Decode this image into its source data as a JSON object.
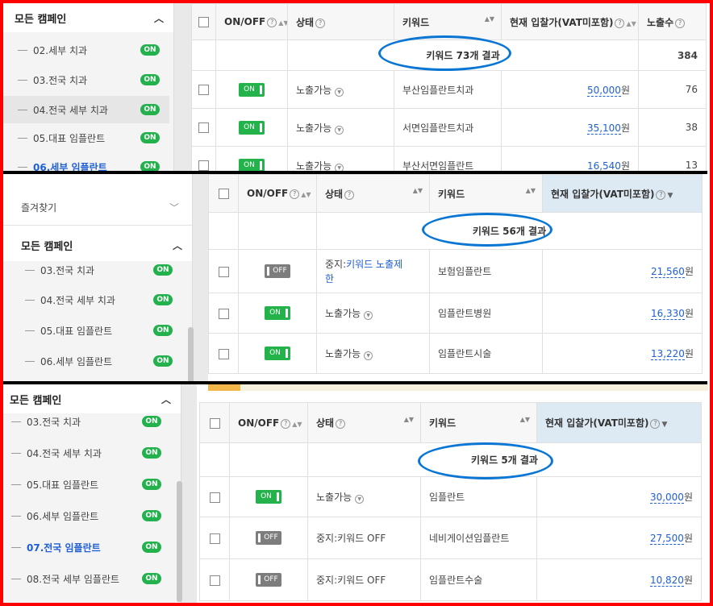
{
  "panels": [
    {
      "sidebar": {
        "header": "모든 캠페인",
        "items": [
          {
            "label": "02.세부 치과",
            "badge": "ON"
          },
          {
            "label": "03.전국 치과",
            "badge": "ON"
          },
          {
            "label": "04.전국 세부 치과",
            "badge": "ON"
          },
          {
            "label": "05.대표 임플란트",
            "badge": "ON"
          },
          {
            "label": "06.세부 임플란트",
            "badge": "ON"
          }
        ]
      },
      "table": {
        "headers": {
          "onoff": "ON/OFF",
          "status": "상태",
          "keyword": "키워드",
          "bid": "현재 입찰가(VAT미포함)",
          "impressions": "노출수"
        },
        "result": "키워드 73개 결과",
        "total_impressions": "384",
        "rows": [
          {
            "toggle": "ON",
            "status": "노출가능",
            "keyword": "부산임플란트치과",
            "bid": "50,000",
            "unit": "원",
            "impressions": "76"
          },
          {
            "toggle": "ON",
            "status": "노출가능",
            "keyword": "서면임플란트치과",
            "bid": "35,100",
            "unit": "원",
            "impressions": "38"
          },
          {
            "toggle": "ON",
            "status": "노출가능",
            "keyword": "부산서면임플란트",
            "bid": "16,540",
            "unit": "원",
            "impressions": "13"
          }
        ]
      }
    },
    {
      "sidebar": {
        "favorites": "즐겨찾기",
        "header": "모든 캠페인",
        "items": [
          {
            "label": "03.전국 치과",
            "badge": "ON"
          },
          {
            "label": "04.전국 세부 치과",
            "badge": "ON"
          },
          {
            "label": "05.대표 임플란트",
            "badge": "ON"
          },
          {
            "label": "06.세부 임플란트",
            "badge": "ON"
          }
        ]
      },
      "table": {
        "headers": {
          "onoff": "ON/OFF",
          "status": "상태",
          "keyword": "키워드",
          "bid": "현재 입찰가(VAT미포함)"
        },
        "result": "키워드 56개 결과",
        "rows": [
          {
            "toggle": "OFF",
            "status_prefix": "중지:",
            "status_link": "키워드 노출제",
            "status_link2": "한",
            "keyword": "보험임플란트",
            "bid": "21,560",
            "unit": "원"
          },
          {
            "toggle": "ON",
            "status": "노출가능",
            "keyword": "임플란트병원",
            "bid": "16,330",
            "unit": "원"
          },
          {
            "toggle": "ON",
            "status": "노출가능",
            "keyword": "임플란트시술",
            "bid": "13,220",
            "unit": "원"
          }
        ]
      }
    },
    {
      "sidebar": {
        "header": "모든 캠페인",
        "items": [
          {
            "label": "03.전국 치과",
            "badge": "ON"
          },
          {
            "label": "04.전국 세부 치과",
            "badge": "ON"
          },
          {
            "label": "05.대표 임플란트",
            "badge": "ON"
          },
          {
            "label": "06.세부 임플란트",
            "badge": "ON"
          },
          {
            "label": "07.전국 임플란트",
            "badge": "ON"
          },
          {
            "label": "08.전국 세부 임플란트",
            "badge": "ON"
          }
        ]
      },
      "table": {
        "headers": {
          "onoff": "ON/OFF",
          "status": "상태",
          "keyword": "키워드",
          "bid": "현재 입찰가(VAT미포함)"
        },
        "result": "키워드 5개 결과",
        "rows": [
          {
            "toggle": "ON",
            "status": "노출가능",
            "keyword": "임플란트",
            "bid": "30,000",
            "unit": "원"
          },
          {
            "toggle": "OFF",
            "status": "중지:키워드 OFF",
            "keyword": "네비게이션임플란트",
            "bid": "27,500",
            "unit": "원"
          },
          {
            "toggle": "OFF",
            "status": "중지:키워드 OFF",
            "keyword": "임플란트수술",
            "bid": "10,820",
            "unit": "원"
          }
        ]
      }
    }
  ],
  "colors": {
    "frame": "#ff0000",
    "annotation": "#0a76d4",
    "on": "#24b24b",
    "off": "#7d7d7d",
    "link": "#1f5fd6"
  }
}
